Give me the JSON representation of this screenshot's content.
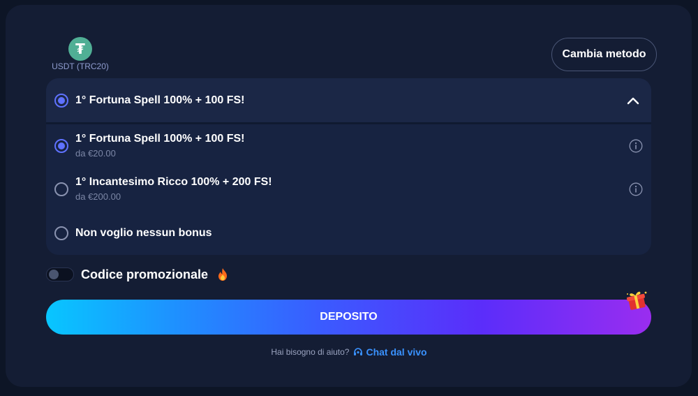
{
  "payment_method": {
    "label": "USDT (TRC20)",
    "logo_glyph": "₮",
    "logo_color": "#50af95",
    "change_label": "Cambia metodo"
  },
  "bonus": {
    "selected_title": "1° Fortuna Spell 100% + 100 FS!",
    "options": [
      {
        "name": "1° Fortuna Spell 100% + 100 FS!",
        "min": "da €20.00",
        "selected": true,
        "has_info": true
      },
      {
        "name": "1° Incantesimo Ricco 100% + 200 FS!",
        "min": "da €200.00",
        "selected": false,
        "has_info": true
      },
      {
        "name": "Non voglio nessun bonus",
        "selected": false,
        "has_info": false
      }
    ]
  },
  "promo": {
    "label": "Codice promozionale",
    "enabled": false,
    "icon": "fire-icon"
  },
  "deposit": {
    "label": "DEPOSITO",
    "gradient": [
      "#08c6ff",
      "#5b2dfa",
      "#9a2df0"
    ]
  },
  "help": {
    "text": "Hai bisogno di aiuto?",
    "chat_label": "Chat dal vivo"
  },
  "colors": {
    "accent": "#5f72ff",
    "link": "#3a92ff",
    "panel": "#141d34",
    "background": "#0d1526"
  }
}
